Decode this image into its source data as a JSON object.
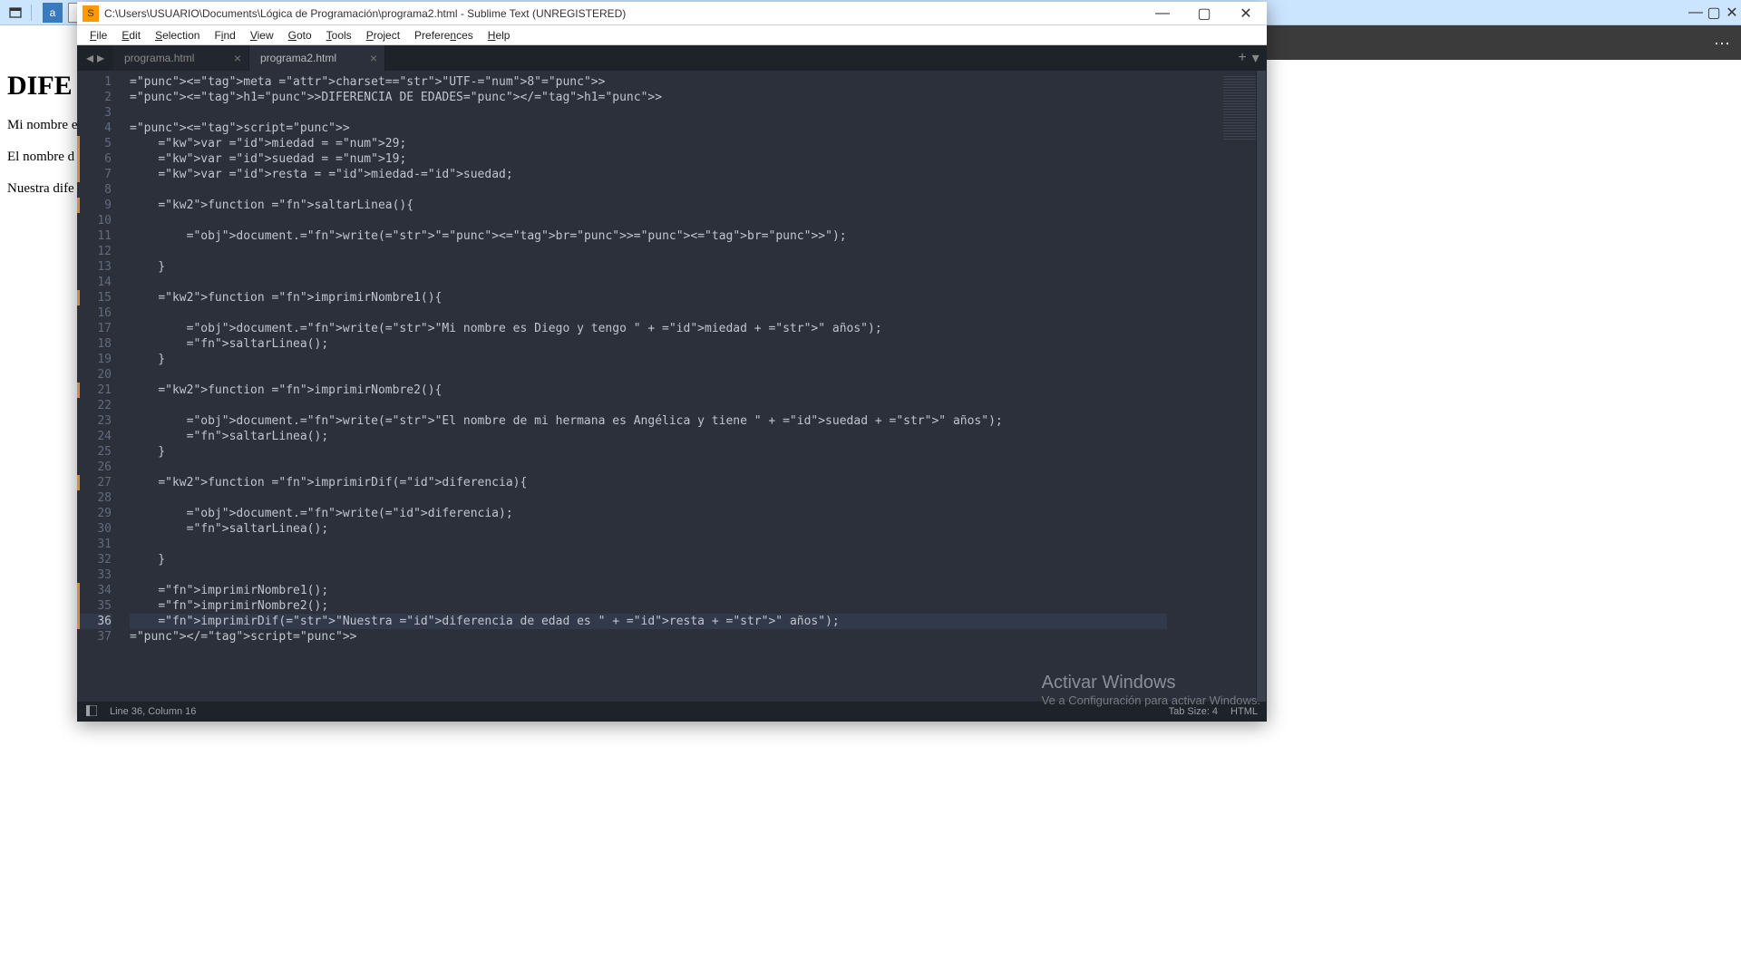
{
  "browser_page": {
    "heading_fragment": "DIFE",
    "p1_fragment": "Mi nombre e",
    "p2_fragment": "El nombre d",
    "p3_fragment": "Nuestra dife"
  },
  "titlebar": {
    "path": "C:\\Users\\USUARIO\\Documents\\Lógica de Programación\\programa2.html - Sublime Text (UNREGISTERED)"
  },
  "menu": {
    "file": "File",
    "edit": "Edit",
    "selection": "Selection",
    "find": "Find",
    "view": "View",
    "goto": "Goto",
    "tools": "Tools",
    "project": "Project",
    "preferences": "Preferences",
    "help": "Help"
  },
  "tabs": {
    "t1": "programa.html",
    "t2": "programa2.html"
  },
  "code": {
    "l1": "<meta charset=\"UTF-8\">",
    "l2": "<h1>DIFERENCIA DE EDADES</h1>",
    "l3": "",
    "l4": "<script>",
    "l5": "    var miedad = 29;",
    "l6": "    var suedad = 19;",
    "l7": "    var resta = miedad-suedad;",
    "l8": "",
    "l9": "    function saltarLinea(){",
    "l10": "",
    "l11": "        document.write(\"<br><br>\");",
    "l12": "",
    "l13": "    }",
    "l14": "",
    "l15": "    function imprimirNombre1(){",
    "l16": "",
    "l17": "        document.write(\"Mi nombre es Diego y tengo \" + miedad + \" años\");",
    "l18": "        saltarLinea();",
    "l19": "    }",
    "l20": "",
    "l21": "    function imprimirNombre2(){",
    "l22": "",
    "l23": "        document.write(\"El nombre de mi hermana es Angélica y tiene \" + suedad + \" años\");",
    "l24": "        saltarLinea();",
    "l25": "    }",
    "l26": "",
    "l27": "    function imprimirDif(diferencia){",
    "l28": "",
    "l29": "        document.write(diferencia);",
    "l30": "        saltarLinea();",
    "l31": "",
    "l32": "    }",
    "l33": "",
    "l34": "    imprimirNombre1();",
    "l35": "    imprimirNombre2();",
    "l36": "    imprimirDif(\"Nuestra diferencia de edad es \" + resta + \" años\");",
    "l37": "</script>"
  },
  "status": {
    "pos": "Line 36, Column 16",
    "tabsize": "Tab Size: 4",
    "syntax": "HTML"
  },
  "watermark": {
    "l1": "Activar Windows",
    "l2": "Ve a Configuración para activar Windows."
  },
  "line_numbers": [
    "1",
    "2",
    "3",
    "4",
    "5",
    "6",
    "7",
    "8",
    "9",
    "10",
    "11",
    "12",
    "13",
    "14",
    "15",
    "16",
    "17",
    "18",
    "19",
    "20",
    "21",
    "22",
    "23",
    "24",
    "25",
    "26",
    "27",
    "28",
    "29",
    "30",
    "31",
    "32",
    "33",
    "34",
    "35",
    "36",
    "37"
  ],
  "modified_lines": [
    5,
    6,
    7,
    9,
    15,
    21,
    27,
    34,
    35,
    36
  ],
  "current_line": 36
}
